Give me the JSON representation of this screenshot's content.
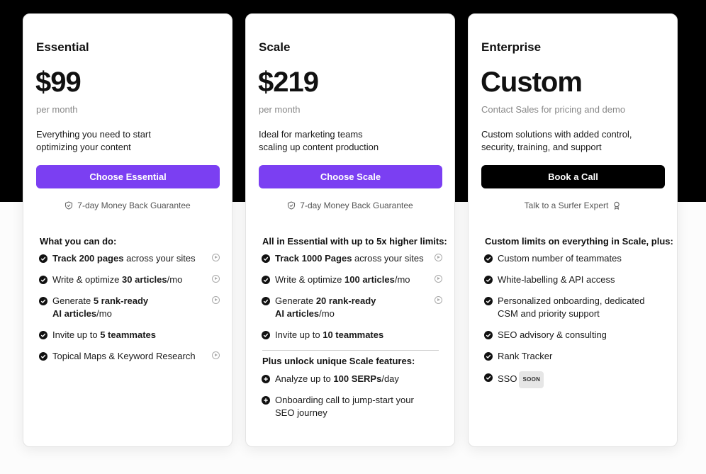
{
  "plans": {
    "essential": {
      "name": "Essential",
      "price": "$99",
      "period": "per month",
      "desc1": "Everything you need to start",
      "desc2": "optimizing your content",
      "cta": "Choose Essential",
      "guarantee": "7-day Money Back Guarantee",
      "section_title": "What you can do:",
      "f1_b": "Track 200 pages",
      "f1_t": " across your sites",
      "f2_t": "Write & optimize ",
      "f2_b": "30 articles",
      "f2_t2": "/mo",
      "f3_t": "Generate ",
      "f3_b": "5 rank-ready",
      "f3_b2": "AI articles",
      "f3_t2": "/mo",
      "f4_t": "Invite up to ",
      "f4_b": "5 teammates",
      "f5_t": "Topical Maps & Keyword Research"
    },
    "scale": {
      "name": "Scale",
      "price": "$219",
      "period": "per month",
      "desc1": "Ideal for marketing teams",
      "desc2": "scaling up content production",
      "cta": "Choose Scale",
      "guarantee": "7-day Money Back Guarantee",
      "section_title": "All in Essential with up to 5x higher limits:",
      "f1_b": "Track 1000 Pages",
      "f1_t": " across your sites",
      "f2_t": "Write & optimize ",
      "f2_b": "100 articles",
      "f2_t2": "/mo",
      "f3_t": "Generate ",
      "f3_b": "20 rank-ready",
      "f3_b2": "AI articles",
      "f3_t2": "/mo",
      "f4_t": "Invite up to ",
      "f4_b": "10 teammates",
      "unlock_title": "Plus unlock unique Scale features:",
      "u1_t": "Analyze up to ",
      "u1_b": "100 SERPs",
      "u1_t2": "/day",
      "u2_l1": "Onboarding call to jump-start your",
      "u2_l2": "SEO journey"
    },
    "enterprise": {
      "name": "Enterprise",
      "price": "Custom",
      "period": "Contact Sales for pricing and demo",
      "desc1": "Custom solutions with added control,",
      "desc2": "security, training, and support",
      "cta": "Book a Call",
      "guarantee": "Talk to a Surfer Expert",
      "section_title": "Custom limits on everything in Scale, plus:",
      "f1": "Custom number of teammates",
      "f2": "White-labelling & API access",
      "f3_l1": "Personalized onboarding, dedicated",
      "f3_l2": "CSM and priority support",
      "f4": "SEO advisory & consulting",
      "f5": "Rank Tracker",
      "f6": "SSO",
      "soon": "SOON"
    }
  },
  "colors": {
    "accent": "#7b3ff2",
    "dark": "#000000"
  }
}
